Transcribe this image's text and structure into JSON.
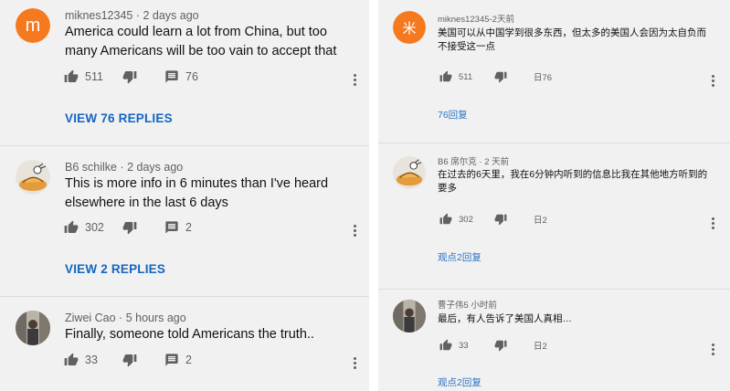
{
  "left": {
    "comments": [
      {
        "author": "miknes12345",
        "time": "2 days ago",
        "avatar_letter": "m",
        "avatar_color": "#f4791f",
        "text": "America could learn a lot from China, but too many Americans will be too vain to accept that",
        "likes": "511",
        "replies_count": "76",
        "view_replies": "VIEW 76 REPLIES"
      },
      {
        "author": "B6 schilke",
        "time": "2 days ago",
        "text": "This is more info in 6 minutes than I've  heard elsewhere in the last 6 days",
        "likes": "302",
        "replies_count": "2",
        "view_replies": "VIEW 2 REPLIES"
      },
      {
        "author": "Ziwei Cao",
        "time": "5 hours ago",
        "text": "Finally, someone told Americans the truth..",
        "likes": "33",
        "replies_count": "2"
      }
    ]
  },
  "right": {
    "comments": [
      {
        "meta": "miknes12345-2天前",
        "avatar_glyph": "米",
        "avatar_color": "#f4791f",
        "text": "美国可以从中国学到很多东西，但太多的美国人会因为太自负而不接受这一点",
        "likes": "511",
        "replies_count": "日76",
        "view_replies": "76回复"
      },
      {
        "meta": "B6 席尔克 · 2 天前",
        "text": "在过去的6天里，我在6分钟内听到的信息比我在其他地方听到的要多",
        "likes": "302",
        "replies_count": "日2",
        "view_replies": "观点2回复"
      },
      {
        "meta": "曹子伟5 小时前",
        "text": "最后，有人告诉了美国人真相…",
        "likes": "33",
        "replies_count": "日2",
        "view_replies": "观点2回复"
      }
    ]
  }
}
